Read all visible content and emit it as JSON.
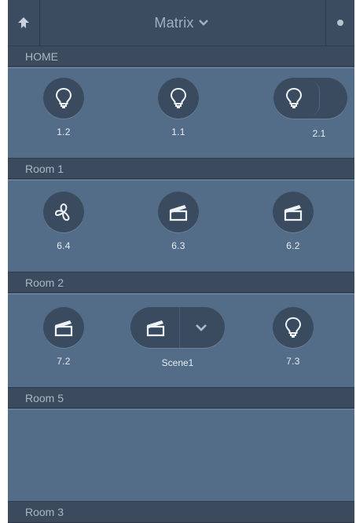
{
  "topbar": {
    "title": "Matrix"
  },
  "sections": {
    "home": {
      "header": "HOME",
      "tiles": [
        {
          "label": "1.2",
          "icon": "lightbulb-icon"
        },
        {
          "label": "1.1",
          "icon": "lightbulb-icon"
        },
        {
          "label": "2.1",
          "icon": "lightbulb-icon"
        }
      ]
    },
    "room1": {
      "header": "Room 1",
      "tiles": [
        {
          "label": "6.4",
          "icon": "fan-icon"
        },
        {
          "label": "6.3",
          "icon": "scene-clapper-icon"
        },
        {
          "label": "6.2",
          "icon": "scene-clapper-icon"
        }
      ]
    },
    "room2": {
      "header": "Room 2",
      "tiles": [
        {
          "label": "7.2",
          "icon": "scene-clapper-icon"
        },
        {
          "label": "Scene1",
          "icon": "scene-clapper-icon"
        },
        {
          "label": "7.3",
          "icon": "lightbulb-icon"
        }
      ]
    },
    "room5": {
      "header": "Room 5"
    },
    "room3": {
      "header": "Room 3"
    }
  }
}
